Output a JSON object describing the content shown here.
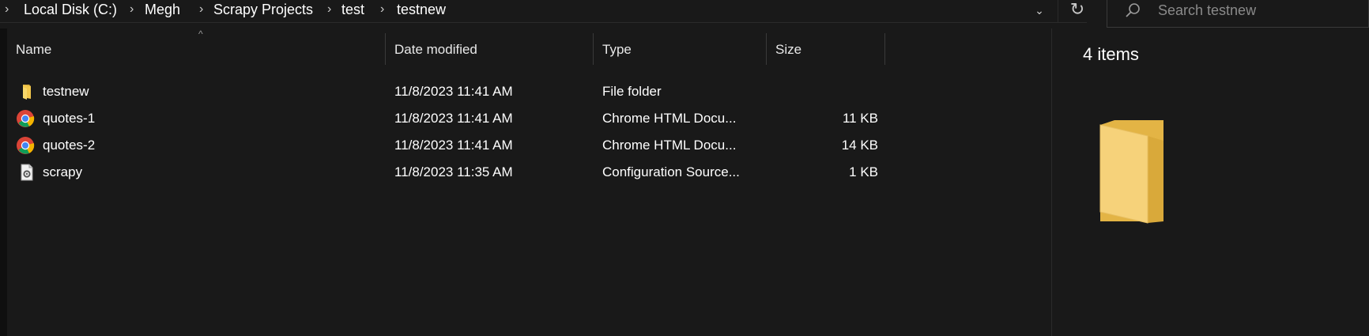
{
  "breadcrumb": {
    "items": [
      "Local Disk (C:)",
      "Megh",
      "Scrapy Projects",
      "test",
      "testnew"
    ],
    "separator": "›"
  },
  "search": {
    "placeholder": "Search testnew"
  },
  "columns": {
    "name": "Name",
    "date": "Date modified",
    "type": "Type",
    "size": "Size"
  },
  "files": [
    {
      "name": "testnew",
      "date": "11/8/2023 11:41 AM",
      "type": "File folder",
      "size": "",
      "icon": "folder-icon"
    },
    {
      "name": "quotes-1",
      "date": "11/8/2023 11:41 AM",
      "type": "Chrome HTML Docu...",
      "size": "11 KB",
      "icon": "chrome-icon"
    },
    {
      "name": "quotes-2",
      "date": "11/8/2023 11:41 AM",
      "type": "Chrome HTML Docu...",
      "size": "14 KB",
      "icon": "chrome-icon"
    },
    {
      "name": "scrapy",
      "date": "11/8/2023 11:35 AM",
      "type": "Configuration Source...",
      "size": "1 KB",
      "icon": "config-file-icon"
    }
  ],
  "details": {
    "count": "4 items",
    "preview_icon": "large-folder-icon"
  },
  "colors": {
    "background": "#191919",
    "text": "#ffffff",
    "folder": "#f4c84c",
    "divider": "#3a3a3a"
  }
}
